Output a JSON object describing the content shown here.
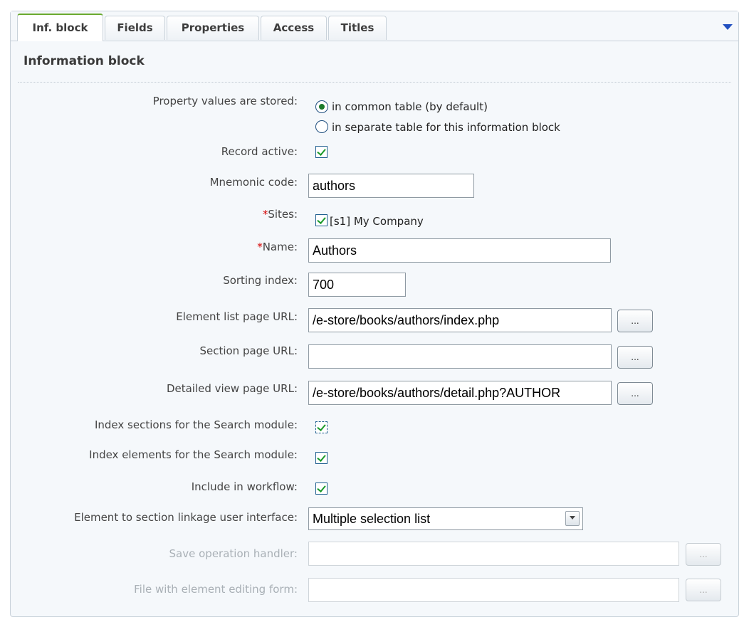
{
  "tabs": [
    {
      "label": "Inf. block",
      "active": true
    },
    {
      "label": "Fields"
    },
    {
      "label": "Properties"
    },
    {
      "label": "Access"
    },
    {
      "label": "Titles"
    }
  ],
  "section_title": "Information block",
  "property_storage": {
    "label": "Property values are stored:",
    "options": [
      "in common table (by default)",
      "in separate table for this information block"
    ],
    "selected": "in common table (by default)"
  },
  "record_active": {
    "label": "Record active:",
    "checked": true
  },
  "mnemonic_code": {
    "label": "Mnemonic code:",
    "value": "authors"
  },
  "sites": {
    "required_mark": "*",
    "label": "Sites:",
    "option": "[s1] My Company",
    "checked": true
  },
  "name": {
    "required_mark": "*",
    "label": "Name:",
    "value": "Authors"
  },
  "sorting_index": {
    "label": "Sorting index:",
    "value": "700"
  },
  "element_list_url": {
    "label": "Element list page URL:",
    "value": "/e-store/books/authors/index.php",
    "button": "..."
  },
  "section_page_url": {
    "label": "Section page URL:",
    "value": "",
    "button": "..."
  },
  "detail_view_url": {
    "label": "Detailed view page URL:",
    "value": "/e-store/books/authors/detail.php?AUTHOR",
    "button": "..."
  },
  "index_sections": {
    "label": "Index sections for the Search module:",
    "checked": true
  },
  "index_elements": {
    "label": "Index elements for the Search module:",
    "checked": true
  },
  "include_workflow": {
    "label": "Include in workflow:",
    "checked": true
  },
  "linkage_ui": {
    "label": "Element to section linkage user interface:",
    "value": "Multiple selection list"
  },
  "save_handler": {
    "label": "Save operation handler:",
    "value": "",
    "button": "..."
  },
  "edit_form_file": {
    "label": "File with element editing form:",
    "value": "",
    "button": "..."
  },
  "colors": {
    "accent_tab": "#6aaa2f",
    "required": "#d40000",
    "check": "#1b9a2a",
    "menu_arrow": "#2250c0"
  }
}
